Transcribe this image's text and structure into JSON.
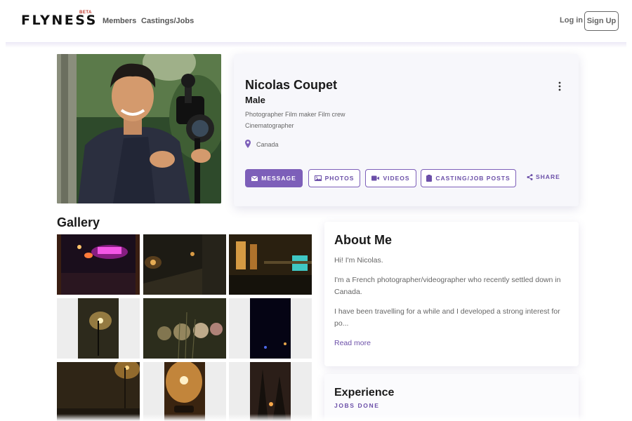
{
  "header": {
    "logo": "FLYNESS",
    "beta": "BETA",
    "nav": [
      {
        "label": "Members"
      },
      {
        "label": "Castings/Jobs"
      }
    ],
    "login": "Log in",
    "signup": "Sign Up"
  },
  "profile": {
    "name": "Nicolas Coupet",
    "gender": "Male",
    "professions_line1": "Photographer Film maker Film crew",
    "professions_line2": "Cinematographer",
    "location": "Canada",
    "buttons": {
      "message": "MESSAGE",
      "photos": "PHOTOS",
      "videos": "VIDEOS",
      "casting": "CASTING/JOB POSTS",
      "share": "SHARE"
    }
  },
  "gallery": {
    "title": "Gallery"
  },
  "about": {
    "title": "About Me",
    "p1": "Hi! I'm Nicolas.",
    "p2": "I'm a French photographer/videographer who recently settled down in Canada.",
    "p3": "I have been travelling for a while and I developed a strong interest for po...",
    "read_more": "Read more"
  },
  "experience": {
    "title": "Experience",
    "subtitle": "JOBS DONE"
  },
  "colors": {
    "accent": "#7d5fb9",
    "accent_text": "#6b4fa8"
  }
}
